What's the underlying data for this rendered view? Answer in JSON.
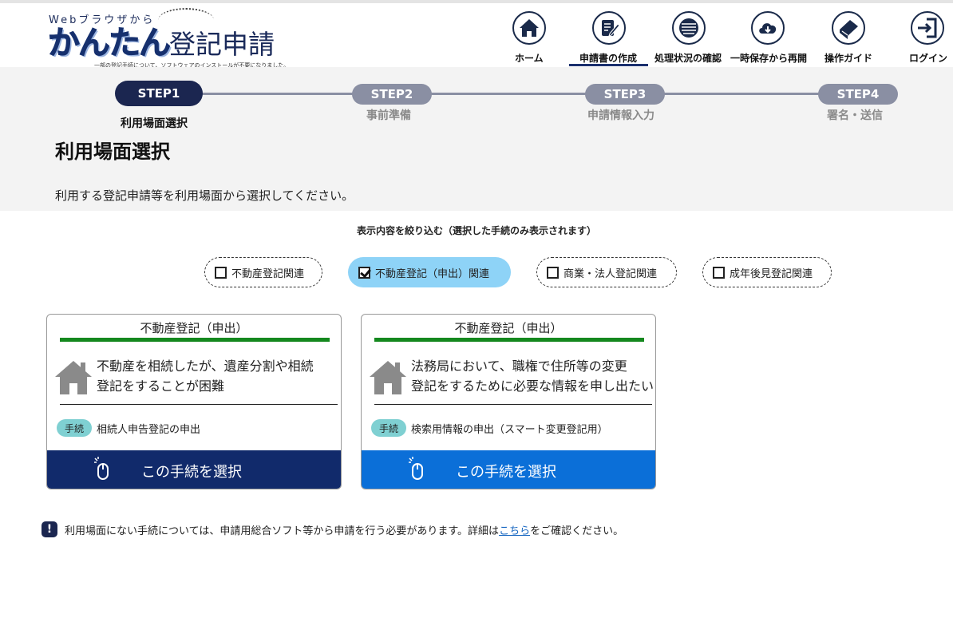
{
  "header": {
    "logo_top": "Webブラウザから",
    "logo_easy": "かんたん",
    "logo_main": "登記申請",
    "logo_sub": "一部の登記手続について、ソフトウェアのインストールが不要になりました。",
    "nav": [
      {
        "label": "ホーム",
        "icon": "home-icon"
      },
      {
        "label": "申請書の作成",
        "icon": "edit-icon",
        "active": true
      },
      {
        "label": "処理状況の確認",
        "icon": "document-list-icon"
      },
      {
        "label": "一時保存から再開",
        "icon": "cloud-download-icon"
      },
      {
        "label": "操作ガイド",
        "icon": "book-icon"
      },
      {
        "label": "ログイン",
        "icon": "login-icon"
      }
    ]
  },
  "steps": [
    {
      "pill": "STEP1",
      "label": "利用場面選択",
      "active": true
    },
    {
      "pill": "STEP2",
      "label": "事前準備",
      "active": false
    },
    {
      "pill": "STEP3",
      "label": "申請情報入力",
      "active": false
    },
    {
      "pill": "STEP4",
      "label": "署名・送信",
      "active": false
    }
  ],
  "page_title": "利用場面選択",
  "instruction": "利用する登記申請等を利用場面から選択してください。",
  "filter": {
    "heading": "表示内容を絞り込む（選択した手続のみ表示されます）",
    "options": [
      {
        "label": "不動産登記関連",
        "checked": false
      },
      {
        "label": "不動産登記（申出）関連",
        "checked": true
      },
      {
        "label": "商業・法人登記関連",
        "checked": false
      },
      {
        "label": "成年後見登記関連",
        "checked": false
      }
    ]
  },
  "cards": [
    {
      "category": "不動産登記（申出）",
      "desc_line1": "不動産を相続したが、遺産分割や相続",
      "desc_line2": "登記をすることが困難",
      "badge": "手続",
      "procedure": "相続人申告登記の申出",
      "button": "この手続を選択",
      "button_color": "#112a6b"
    },
    {
      "category": "不動産登記（申出）",
      "desc_line1": "法務局において、職権で住所等の変更",
      "desc_line2": "登記をするために必要な情報を申し出たい",
      "badge": "手続",
      "procedure": "検索用情報の申出（スマート変更登記用）",
      "button": "この手続を選択",
      "button_color": "#0b6fd8"
    }
  ],
  "notice": {
    "icon": "exclamation-icon",
    "text_before": "利用場面にない手続については、申請用総合ソフト等から申請を行う必要があります。詳細は",
    "link": "こちら",
    "text_after": "をご確認ください。"
  },
  "colors": {
    "brand_navy": "#1b2650",
    "step_inactive": "#8a8fa3",
    "category_bar": "#14881e",
    "chip_checked": "#8ed3f7"
  }
}
